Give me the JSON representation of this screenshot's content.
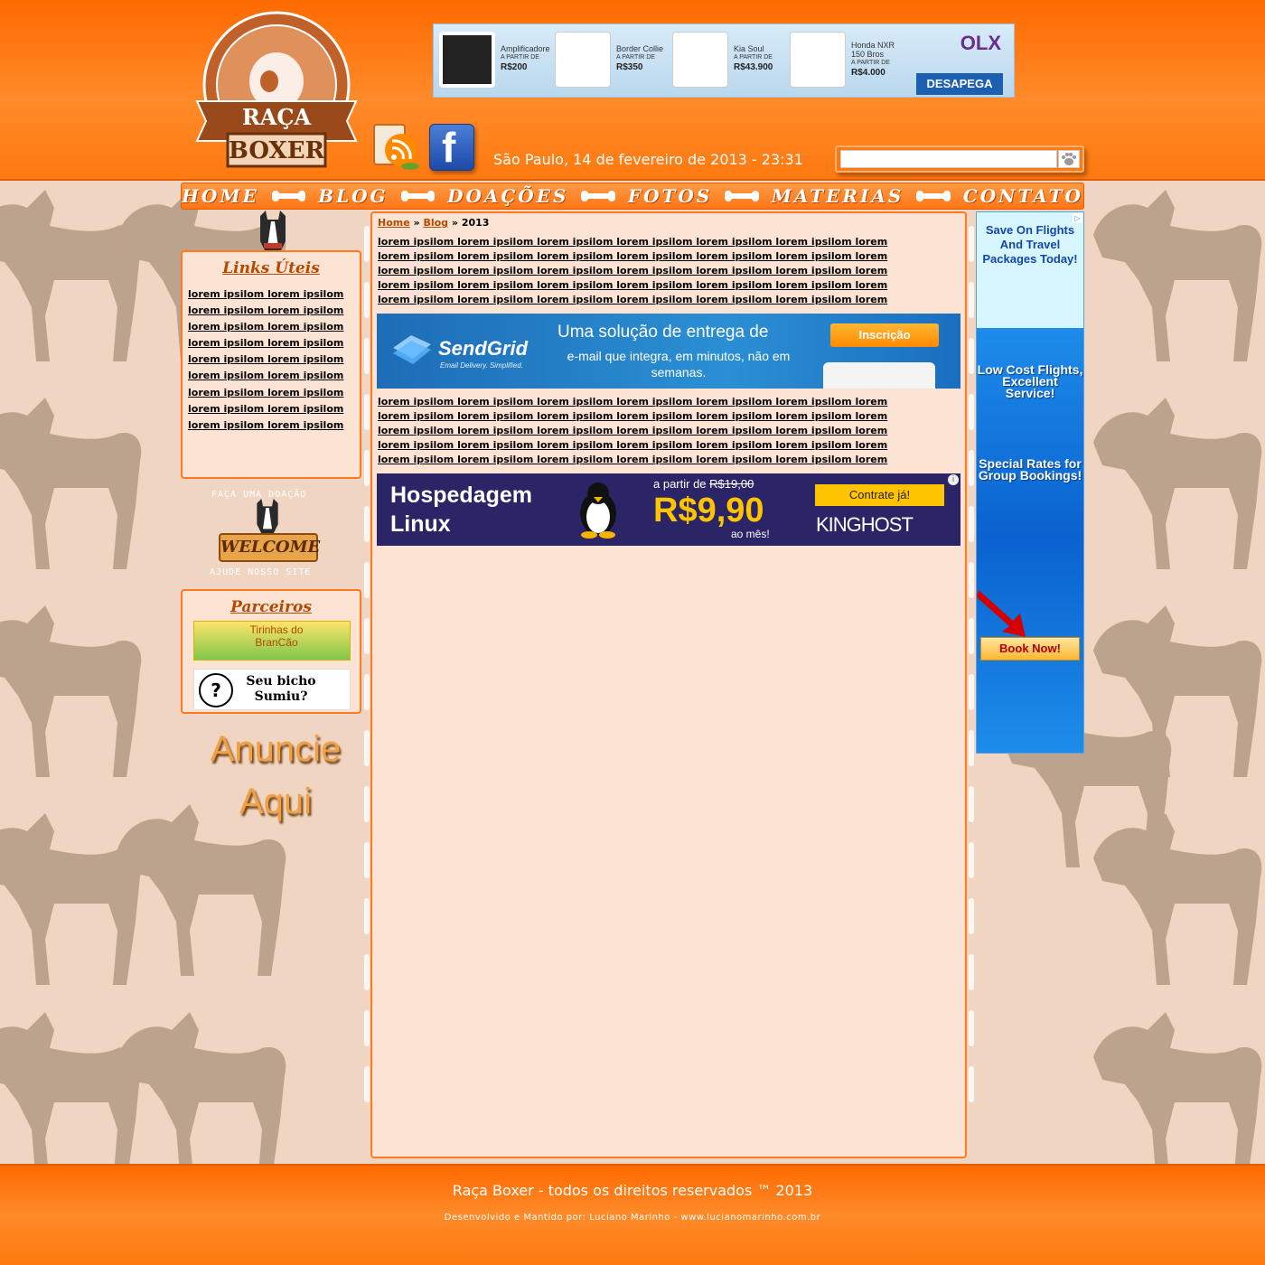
{
  "site": {
    "logo_line1": "RAÇA",
    "logo_line2": "BOXER"
  },
  "top_ad": {
    "items": [
      {
        "name": "Amplificadore",
        "from": "A PARTIR DE",
        "price": "R$200"
      },
      {
        "name": "Border Collie",
        "from": "A PARTIR DE",
        "price": "R$350"
      },
      {
        "name": "Kia Soul",
        "from": "A PARTIR DE",
        "price": "R$43.900"
      },
      {
        "name": "Honda NXR 150 Bros",
        "from": "A PARTIR DE",
        "price": "R$4.000"
      }
    ],
    "brand": "OLX",
    "slogan": "DESAPEGA"
  },
  "header": {
    "date_line": "São Paulo, 14 de fevereiro de 2013 - 23:31",
    "search_value": "",
    "search_placeholder": ""
  },
  "nav": {
    "items": [
      "HOME",
      "BLOG",
      "DOAÇÕES",
      "FOTOS",
      "MATERIAS",
      "CONTATO"
    ]
  },
  "sidebar": {
    "links_title": "Links Úteis",
    "links": [
      "lorem ipsilom lorem ipsilom",
      "lorem ipsilom lorem ipsilom",
      "lorem ipsilom lorem ipsilom",
      "lorem ipsilom lorem ipsilom",
      "lorem ipsilom lorem ipsilom",
      "lorem ipsilom lorem ipsilom",
      "lorem ipsilom lorem ipsilom",
      "lorem ipsilom lorem ipsilom",
      "lorem ipsilom lorem ipsilom"
    ],
    "donate_text": "FAÇA UMA DOAÇÃO",
    "welcome_text": "WELCOME",
    "help_text": "AJUDE NOSSO SITE",
    "partners_title": "Parceiros",
    "partner1": "Tirinhas do BranCão",
    "partner2": "Seu bicho Sumiu?",
    "anuncie_line1": "Anuncie",
    "anuncie_line2": "Aqui"
  },
  "main": {
    "breadcrumb": {
      "home": "Home",
      "sep1": " » ",
      "blog": "Blog",
      "sep2": " » ",
      "current": "2013"
    },
    "para1": [
      "lorem ipsilom lorem ipsilom lorem ipsilom lorem ipsilom lorem ipsilom lorem ipsilom  lorem",
      "lorem ipsilom lorem ipsilom lorem ipsilom lorem ipsilom lorem ipsilom lorem ipsilom  lorem",
      "lorem ipsilom lorem ipsilom lorem ipsilom lorem ipsilom lorem ipsilom lorem ipsilom  lorem",
      "lorem ipsilom lorem ipsilom lorem ipsilom lorem ipsilom lorem ipsilom lorem ipsilom  lorem",
      "lorem ipsilom lorem ipsilom lorem ipsilom lorem ipsilom lorem ipsilom lorem ipsilom  lorem"
    ],
    "para2": [
      "lorem ipsilom lorem ipsilom lorem ipsilom lorem ipsilom lorem ipsilom lorem ipsilom  lorem",
      "lorem ipsilom lorem ipsilom lorem ipsilom lorem ipsilom lorem ipsilom lorem ipsilom  lorem",
      "lorem ipsilom lorem ipsilom lorem ipsilom lorem ipsilom lorem ipsilom lorem ipsilom  lorem",
      "lorem ipsilom lorem ipsilom lorem ipsilom lorem ipsilom lorem ipsilom lorem ipsilom  lorem",
      "lorem ipsilom lorem ipsilom lorem ipsilom lorem ipsilom lorem ipsilom lorem ipsilom  lorem"
    ],
    "sendgrid_ad": {
      "logo": "SendGrid",
      "tagline": "Email Delivery. Simplified.",
      "headline": "Uma solução de entrega de",
      "sub": "e-mail que integra, em minutos, não em semanas.",
      "button": "Inscrição"
    },
    "kinghost_ad": {
      "title": "Hospedagem Linux",
      "from_prefix": "a partir de",
      "old_price": "R$19,00",
      "price": "R$9,90",
      "per": "ao mês!",
      "button": "Contrate já!",
      "brand": "KINGHOST",
      "info": "i"
    }
  },
  "right_ad": {
    "top": "Save On Flights And Travel Packages Today!",
    "mid": "Low Cost Flights, Excellent Service!",
    "mid2": "Special Rates for Group Bookings!",
    "button": "Book Now!"
  },
  "footer": {
    "main": "Raça Boxer - todos os direitos reservados ™ 2013",
    "sub": "Desenvolvido e Mantido por: Luciano Marinho - www.lucianomarinho.com.br"
  },
  "colors": {
    "header_orange": "#ff7a10",
    "panel_bg": "#fde3d3",
    "border_orange": "#ff7a20",
    "page_bg": "#f0d6c2"
  }
}
